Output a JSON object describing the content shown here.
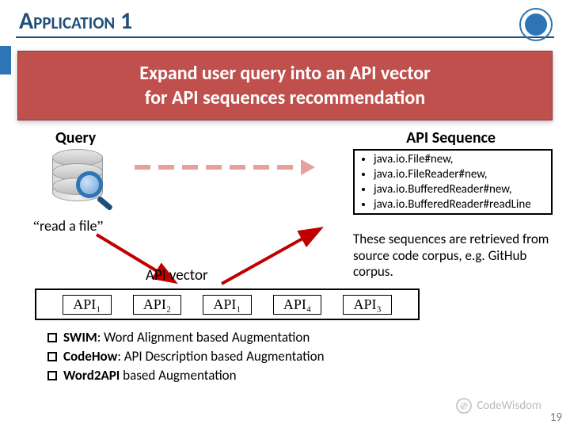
{
  "title": "Application 1",
  "banner_line1": "Expand user query into an API vector",
  "banner_line2": "for API sequences recommendation",
  "labels": {
    "query": "Query",
    "api_sequence": "API Sequence",
    "api_vector": "API vector",
    "read_a_file": "read a file"
  },
  "api_sequence": [
    "java.io.File#new,",
    "java.io.FileReader#new,",
    "java.io.BufferedReader#new,",
    "java.io.BufferedReader#readLine"
  ],
  "sequence_note": "These sequences are retrieved from source code corpus, e.g. GitHub corpus.",
  "api_vector": [
    "API₁",
    "API₂",
    "API₁",
    "API₄",
    "API₃"
  ],
  "augmentations": [
    {
      "name": "SWIM",
      "desc": ": Word Alignment based Augmentation"
    },
    {
      "name": "CodeHow",
      "desc": ": API Description based Augmentation"
    },
    {
      "name": "Word2API",
      "desc": " based Augmentation"
    }
  ],
  "watermark": "CodeWisdom",
  "page_number": "19"
}
